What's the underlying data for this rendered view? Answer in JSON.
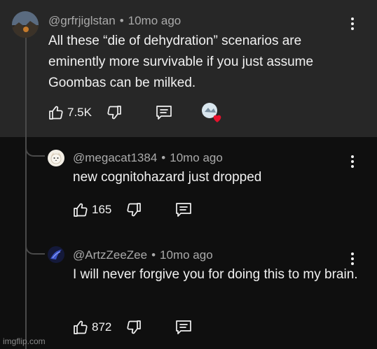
{
  "comments": [
    {
      "handle": "@grfrjiglstan",
      "time": "10mo ago",
      "text": "All these “die of dehydration” scenarios are eminently more survivable if you just assume Goombas can be milked.",
      "likes": "7.5K",
      "creator_heart": true
    },
    {
      "handle": "@megacat1384",
      "time": "10mo ago",
      "text": "new cognitohazard just dropped",
      "likes": "165"
    },
    {
      "handle": "@ArtzZeeZee",
      "time": "10mo ago",
      "text": "I will never forgive you for doing this to my brain.",
      "likes": "872"
    }
  ],
  "separator": "•",
  "watermark": "imgflip.com",
  "colors": {
    "highlight_bg": "#272727",
    "page_bg": "#0f0f0f",
    "heart": "#e8112d",
    "meta_text": "#aaaaaa"
  },
  "icons": [
    "like-icon",
    "dislike-icon",
    "reply-icon",
    "more-vert-icon",
    "creator-heart-icon"
  ]
}
